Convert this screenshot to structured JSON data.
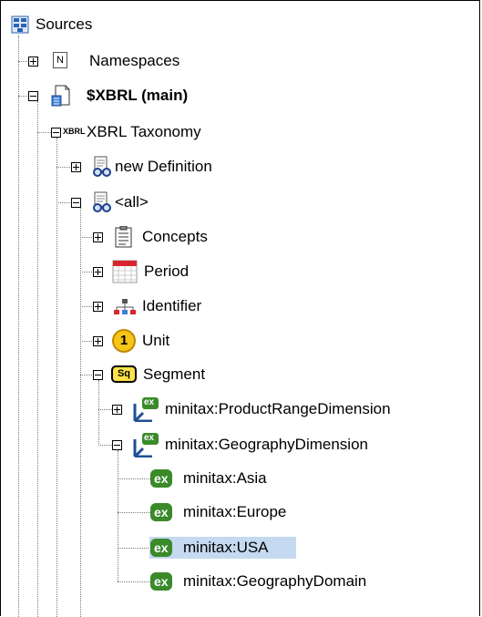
{
  "tree": {
    "root": {
      "label": "Sources",
      "icon": "sources-icon"
    },
    "namespaces": {
      "label": "Namespaces",
      "icon_glyph": "N"
    },
    "xbrl_main": {
      "label": "$XBRL (main)",
      "icon": "document-icon"
    },
    "taxonomy": {
      "label": "XBRL Taxonomy",
      "tag": "XBRL"
    },
    "new_definition": {
      "label": "new Definition",
      "icon": "glasses-icon"
    },
    "all": {
      "label": "<all>",
      "icon": "glasses-icon"
    },
    "concepts": {
      "label": "Concepts",
      "icon": "list-icon"
    },
    "period": {
      "label": "Period",
      "icon": "calendar-icon"
    },
    "identifier": {
      "label": "Identifier",
      "icon": "hierarchy-icon"
    },
    "unit": {
      "label": "Unit",
      "icon_glyph": "1"
    },
    "segment": {
      "label": "Segment",
      "icon_glyph": "Sq"
    },
    "product_range": {
      "label": "minitax:ProductRangeDimension",
      "icon_glyph": "ex"
    },
    "geography": {
      "label": "minitax:GeographyDimension",
      "icon_glyph": "ex"
    },
    "members": [
      {
        "label": "minitax:Asia",
        "badge": "ex"
      },
      {
        "label": "minitax:Europe",
        "badge": "ex"
      },
      {
        "label": "minitax:USA",
        "badge": "ex"
      },
      {
        "label": "minitax:GeographyDomain",
        "badge": "ex"
      }
    ]
  },
  "colors": {
    "selection": "#c5d9f1",
    "member_badge": "#3a8a2a",
    "unit_badge": "#f5c518"
  }
}
